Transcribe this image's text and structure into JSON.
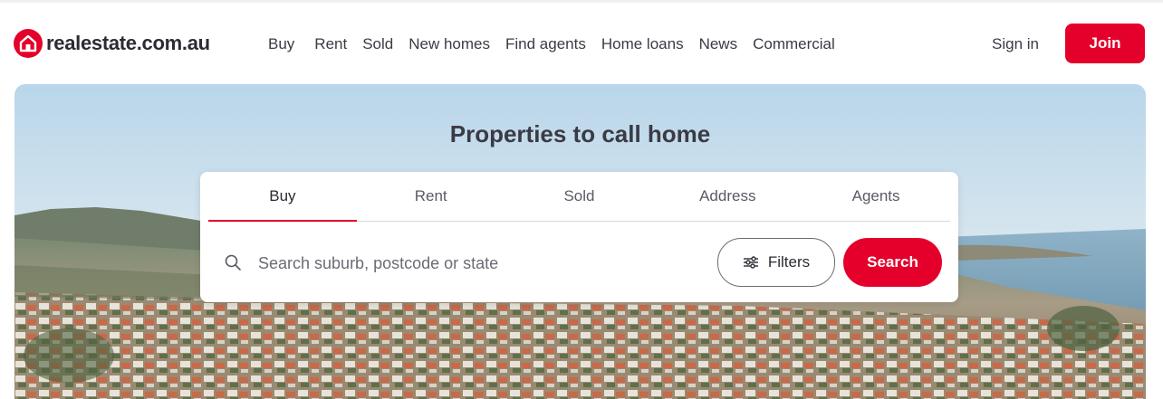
{
  "header": {
    "logo_text": "realestate.com.au",
    "nav": [
      "Buy",
      "Rent",
      "Sold",
      "New homes",
      "Find agents",
      "Home loans",
      "News",
      "Commercial"
    ],
    "signin_label": "Sign in",
    "join_label": "Join"
  },
  "hero": {
    "title": "Properties to call home"
  },
  "search": {
    "tabs": [
      "Buy",
      "Rent",
      "Sold",
      "Address",
      "Agents"
    ],
    "active_tab": "Buy",
    "placeholder": "Search suburb, postcode or state",
    "filters_label": "Filters",
    "search_label": "Search"
  },
  "colors": {
    "brand": "#e4002b",
    "text": "#3b3b45"
  },
  "icons": [
    "house-logo-icon",
    "search-icon",
    "filters-sliders-icon"
  ]
}
